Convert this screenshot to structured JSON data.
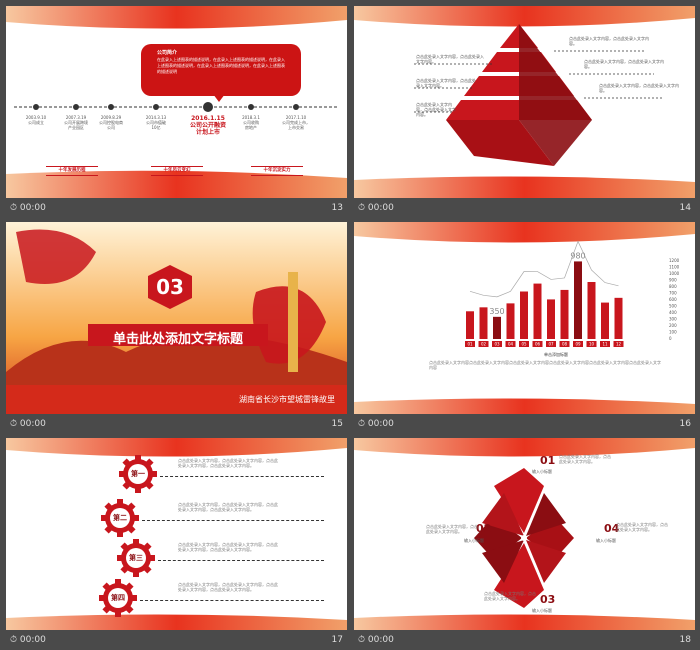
{
  "slides": [
    {
      "number": "13",
      "time": "00:00",
      "bubble_title": "公司简介",
      "bubble_text": "在此录入上述图表的描述说明，在此录入上述图表的描述说明，在此录入上述图表的描述说明，在此录入上述图表的描述说明，在此录入上述图表的描述说明",
      "milestones": [
        {
          "date": "2003.9.10",
          "desc": "公司成立"
        },
        {
          "date": "2007.3.19",
          "desc": "公司开展跨境\n产业园区"
        },
        {
          "date": "2009.8.29",
          "desc": "公司控股电商\n公司"
        },
        {
          "date": "2014.3.13",
          "desc": "公司市值破\n10亿"
        },
        {
          "date": "2016.1.15",
          "desc": "公司公开融资\n计划上市",
          "highlight": true
        },
        {
          "date": "2018.3.1",
          "desc": "公司收购\n房地产"
        },
        {
          "date": "2017.1.10",
          "desc": "公司完成上市，\n上市交易"
        }
      ],
      "tags": [
        "十年发展历程",
        "十年风云变幻",
        "十年沉淀实力"
      ]
    },
    {
      "number": "14",
      "time": "00:00",
      "left_texts": [
        "点击此处录入文字内容，点击此处录入文字内容。",
        "点击此处录入文字内容，点击此处录入文字内容。",
        "点击此处录入文字内容，点击此处录入文字内容。"
      ],
      "right_texts": [
        "点击此处录入文字内容，点击此处录入文字内容。",
        "点击此处录入文字内容，点击此处录入文字内容。",
        "点击此处录入文字内容，点击此处录入文字内容。"
      ]
    },
    {
      "number": "15",
      "time": "00:00",
      "section_number": "03",
      "title": "单击此处添加文字标题",
      "caption": "湖南省长沙市望城雷锋故里"
    },
    {
      "number": "16",
      "time": "00:00",
      "chart_title": "单击添加标题",
      "body_text": "点击此处录入文字内容点击此处录入文字内容点击此处录入文字内容点击此处录入文字内容点击此处录入文字内容点击此处录入文字内容"
    },
    {
      "number": "17",
      "time": "00:00",
      "gears": [
        "第一",
        "第二",
        "第三",
        "第四"
      ],
      "item_text": "点击此处录入文字内容，点击此处录入文字内容，点击此处录入文字内容，点击此处录入文字内容。"
    },
    {
      "number": "18",
      "time": "00:00",
      "quadrants": [
        {
          "num": "01",
          "label": "输入小标题"
        },
        {
          "num": "02",
          "label": "输入小标题"
        },
        {
          "num": "03",
          "label": "输入小标题"
        },
        {
          "num": "04",
          "label": "输入小标题"
        }
      ],
      "quad_text": "点击此处录入文字内容，点击此处录入文字内容。"
    }
  ],
  "chart_data": {
    "type": "bar",
    "categories": [
      "01",
      "02",
      "03",
      "04",
      "05",
      "06",
      "07",
      "08",
      "09",
      "10",
      "11",
      "12"
    ],
    "values": [
      350,
      400,
      280,
      450,
      600,
      700,
      500,
      620,
      980,
      720,
      460,
      520
    ],
    "annotations": [
      {
        "category": "03",
        "label": "350"
      },
      {
        "category": "09",
        "label": "980"
      }
    ],
    "y_ticks": [
      "1200",
      "1100",
      "1000",
      "900",
      "800",
      "700",
      "600",
      "500",
      "400",
      "300",
      "200",
      "100",
      "0"
    ],
    "ylim": [
      0,
      1200
    ],
    "line_overlay": true
  },
  "colors": {
    "accent": "#c8161d",
    "dark": "#8b0d12",
    "bar_bg": "#4a4a4a"
  }
}
